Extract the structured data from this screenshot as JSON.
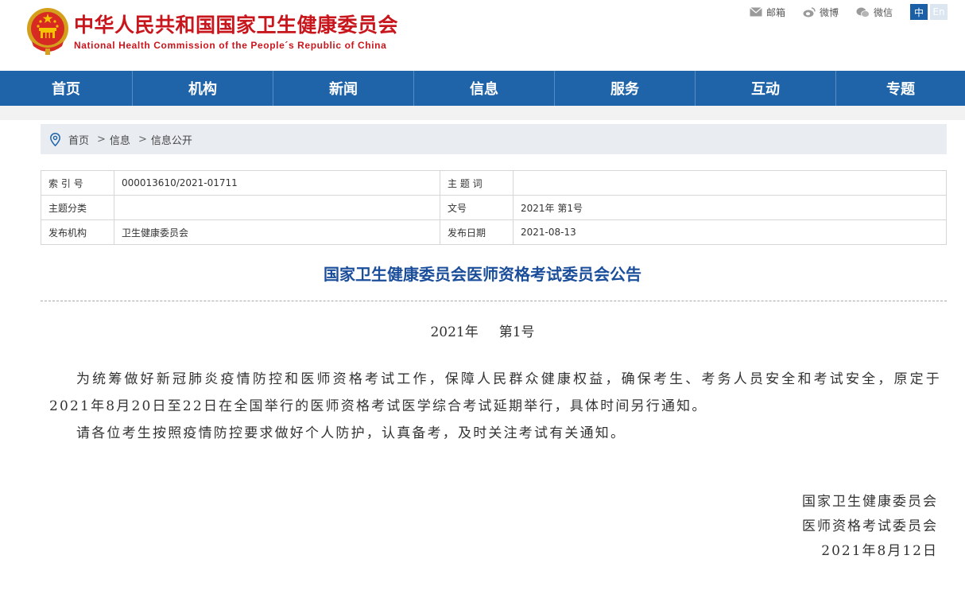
{
  "header": {
    "title_cn": "中华人民共和国国家卫生健康委员会",
    "title_en": "National Health Commission of the People´s Republic of China",
    "links": [
      {
        "label": "邮箱",
        "icon": "mail-icon"
      },
      {
        "label": "微博",
        "icon": "weibo-icon"
      },
      {
        "label": "微信",
        "icon": "wechat-icon"
      }
    ],
    "lang_zh": "中",
    "lang_en": "En"
  },
  "nav": {
    "items": [
      "首页",
      "机构",
      "新闻",
      "信息",
      "服务",
      "互动",
      "专题"
    ]
  },
  "breadcrumb": {
    "items": [
      "首页",
      "信息",
      "信息公开"
    ],
    "separator": ">"
  },
  "meta": {
    "rows": [
      [
        {
          "k": "索 引 号",
          "v": "000013610/2021-01711"
        },
        {
          "k": "主 题 词",
          "v": ""
        }
      ],
      [
        {
          "k": "主题分类",
          "v": ""
        },
        {
          "k": "文号",
          "v": "2021年 第1号"
        }
      ],
      [
        {
          "k": "发布机构",
          "v": "卫生健康委员会"
        },
        {
          "k": "发布日期",
          "v": "2021-08-13"
        }
      ]
    ]
  },
  "article": {
    "title": "国家卫生健康委员会医师资格考试委员会公告",
    "doc_year": "2021年",
    "doc_number": "第1号",
    "paragraphs": [
      "为统筹做好新冠肺炎疫情防控和医师资格考试工作，保障人民群众健康权益，确保考生、考务人员安全和考试安全，原定于2021年8月20日至22日在全国举行的医师资格考试医学综合考试延期举行，具体时间另行通知。",
      "请各位考生按照疫情防控要求做好个人防护，认真备考，及时关注考试有关通知。"
    ],
    "signature": [
      "国家卫生健康委员会",
      "医师资格考试委员会",
      "2021年8月12日"
    ]
  },
  "colors": {
    "brand_red": "#c8161d",
    "nav_blue": "#1f64a8",
    "title_blue": "#1b4e9a"
  }
}
